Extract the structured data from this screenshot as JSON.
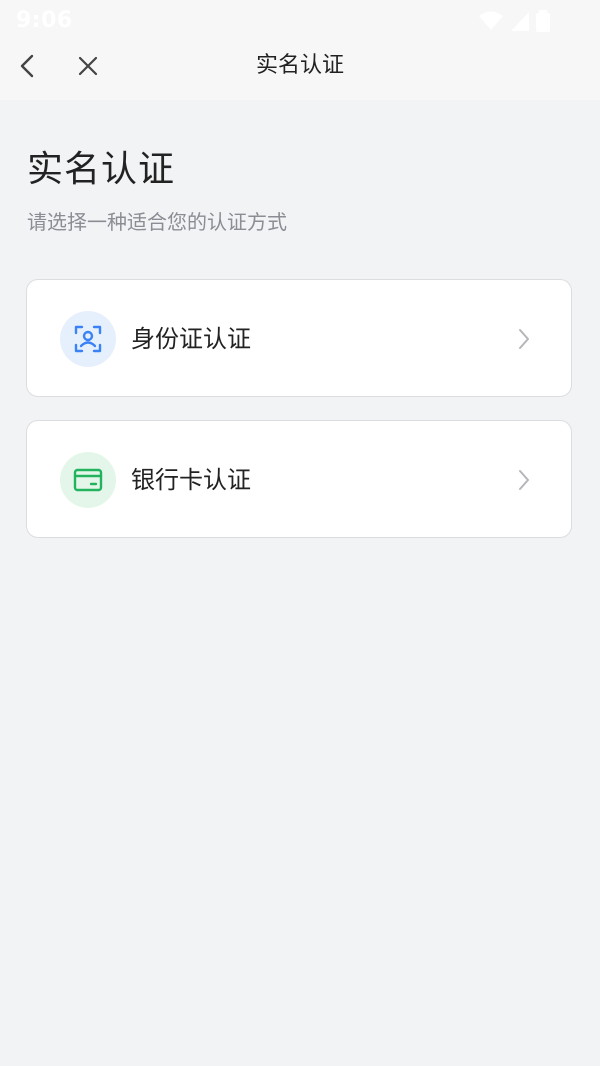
{
  "status_bar": {
    "time": "9:06"
  },
  "nav": {
    "title": "实名认证"
  },
  "page": {
    "title": "实名认证",
    "subtitle": "请选择一种适合您的认证方式"
  },
  "options": [
    {
      "label": "身份证认证",
      "icon": "id-card-scan-icon",
      "accent": "#3b82f6"
    },
    {
      "label": "银行卡认证",
      "icon": "bank-card-icon",
      "accent": "#22b35e"
    }
  ],
  "colors": {
    "background": "#f2f3f5",
    "nav_background": "#f7f7f8",
    "text_primary": "#222222",
    "text_secondary": "#8a8d93",
    "chevron": "#b4b6ba"
  }
}
